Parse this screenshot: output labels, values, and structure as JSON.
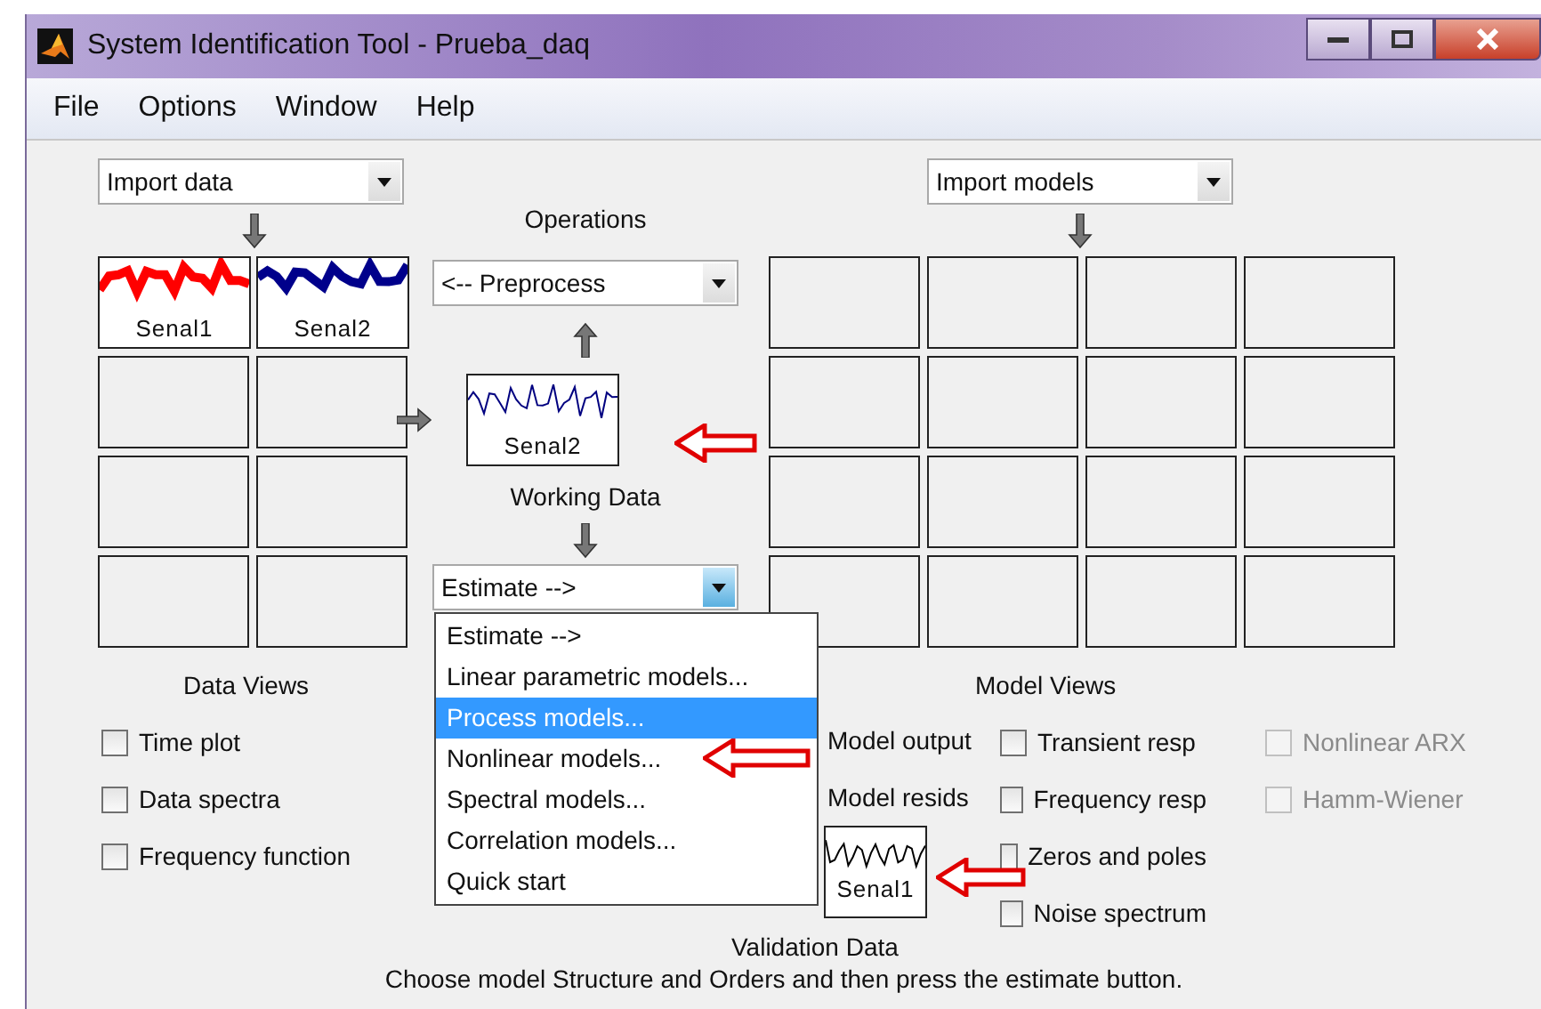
{
  "window": {
    "title": "System Identification Tool - Prueba_daq"
  },
  "menu_bar": [
    "File",
    "Options",
    "Window",
    "Help"
  ],
  "data_import": {
    "value": "Import data"
  },
  "data_slots": [
    {
      "label": "Senal1",
      "color": "#ff0000"
    },
    {
      "label": "Senal2",
      "color": "#00008b"
    }
  ],
  "operations": {
    "title": "Operations",
    "preprocess": "<-- Preprocess",
    "working_data": {
      "label": "Senal2",
      "caption": "Working Data"
    },
    "estimate": "Estimate -->"
  },
  "estimate_menu": [
    {
      "label": "Estimate -->",
      "selected": false
    },
    {
      "label": "Linear parametric models...",
      "selected": false
    },
    {
      "label": "Process models...",
      "selected": true
    },
    {
      "label": "Nonlinear models...",
      "selected": false
    },
    {
      "label": "Spectral models...",
      "selected": false
    },
    {
      "label": "Correlation models...",
      "selected": false
    },
    {
      "label": "Quick start",
      "selected": false
    }
  ],
  "model_import": {
    "value": "Import models"
  },
  "data_views": {
    "title": "Data Views",
    "options": [
      {
        "label": "Time plot",
        "checked": false
      },
      {
        "label": "Data spectra",
        "checked": false
      },
      {
        "label": "Frequency function",
        "checked": false
      }
    ]
  },
  "validation": {
    "options": [
      "Model output",
      "Model resids"
    ],
    "data": {
      "label": "Senal1",
      "caption": "Validation Data"
    }
  },
  "model_views": {
    "title": "Model Views",
    "columns": [
      [
        {
          "label": "Transient resp",
          "checked": false,
          "disabled": false
        },
        {
          "label": "Frequency resp",
          "checked": false,
          "disabled": false
        },
        {
          "label": "Zeros and poles",
          "checked": false,
          "disabled": false
        },
        {
          "label": "Noise spectrum",
          "checked": false,
          "disabled": false
        }
      ],
      [
        {
          "label": "Nonlinear ARX",
          "checked": false,
          "disabled": true
        },
        {
          "label": "Hamm-Wiener",
          "checked": false,
          "disabled": true
        }
      ]
    ]
  },
  "hint": "Choose model Structure and Orders and then press the estimate button."
}
